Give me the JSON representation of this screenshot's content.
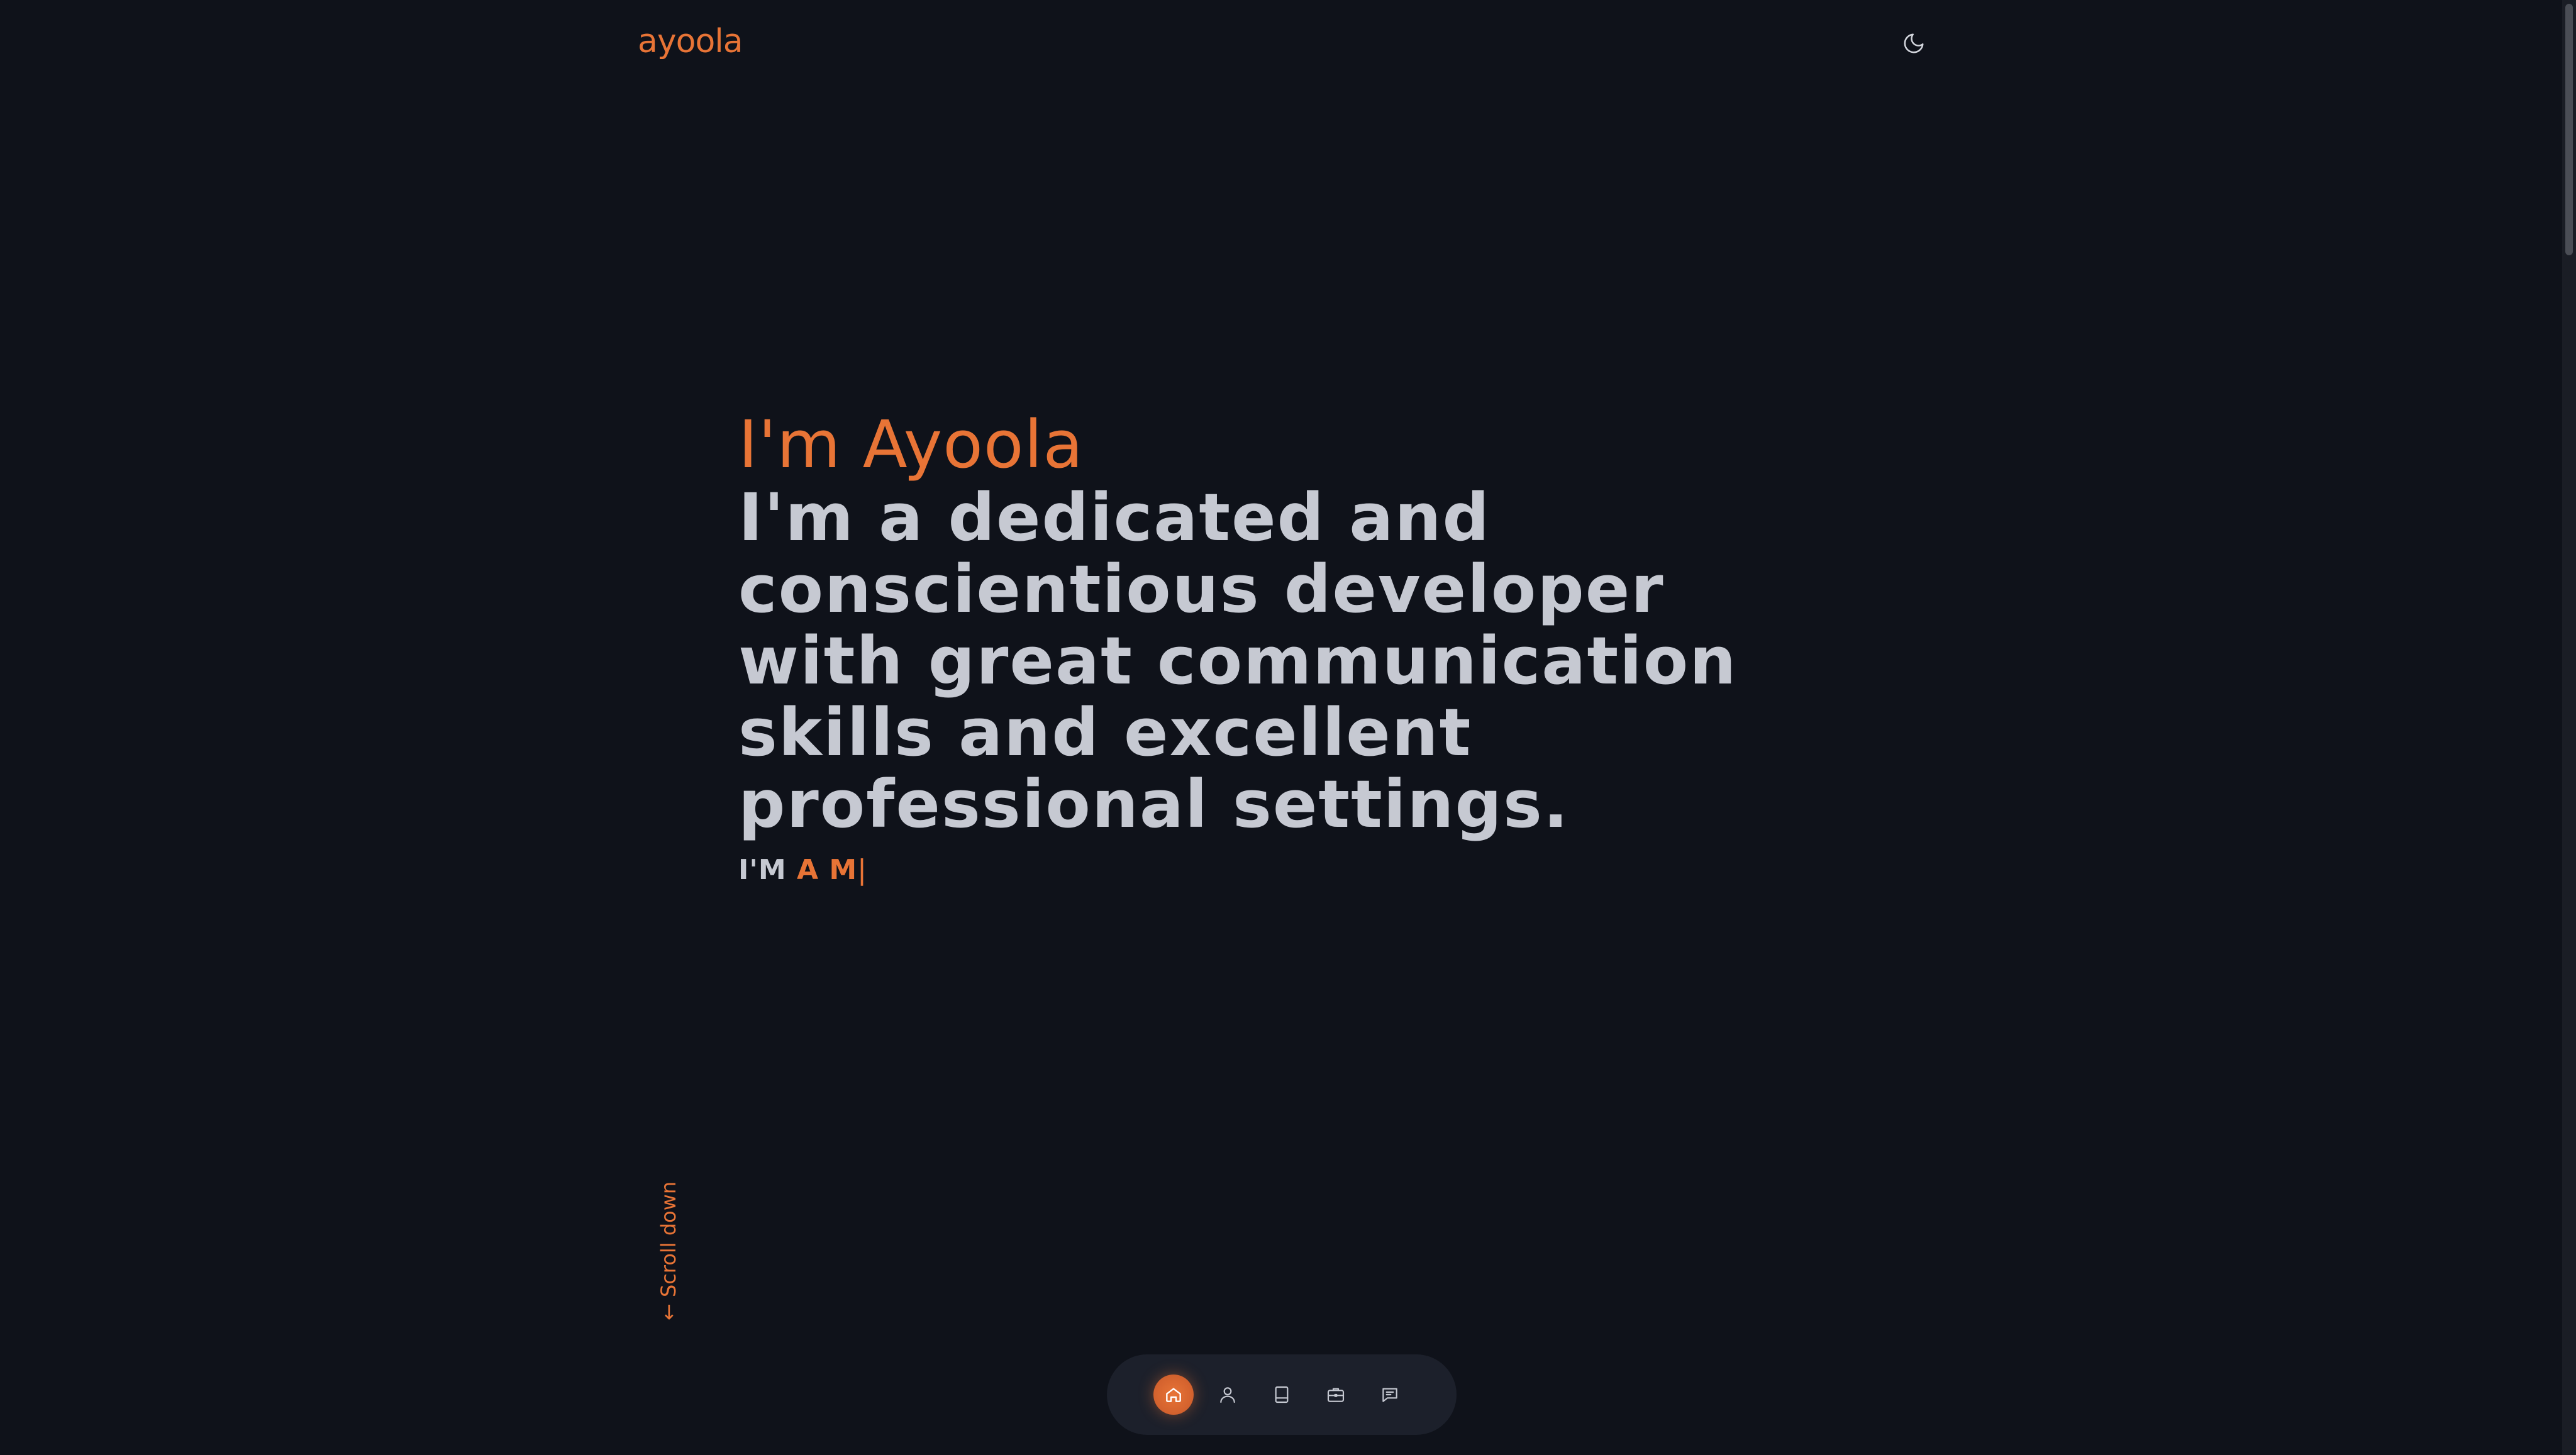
{
  "header": {
    "logo": "ayoola",
    "theme_toggle_icon": "moon-icon"
  },
  "hero": {
    "name": "I'm Ayoola",
    "description": "I'm a dedicated and conscientious developer with great communication skills and excellent professional settings.",
    "role_prefix": "I'M",
    "role_typed": "A M",
    "role_cursor": "|"
  },
  "scroll_down": {
    "label": "← Scroll down"
  },
  "dock": {
    "items": [
      {
        "icon": "home-icon",
        "active": true
      },
      {
        "icon": "user-icon",
        "active": false
      },
      {
        "icon": "book-icon",
        "active": false
      },
      {
        "icon": "briefcase-icon",
        "active": false
      },
      {
        "icon": "message-icon",
        "active": false
      }
    ]
  },
  "colors": {
    "background": "#0f121a",
    "accent": "#e87436",
    "text": "#c6c9d2",
    "dock_background": "#1c202b"
  }
}
